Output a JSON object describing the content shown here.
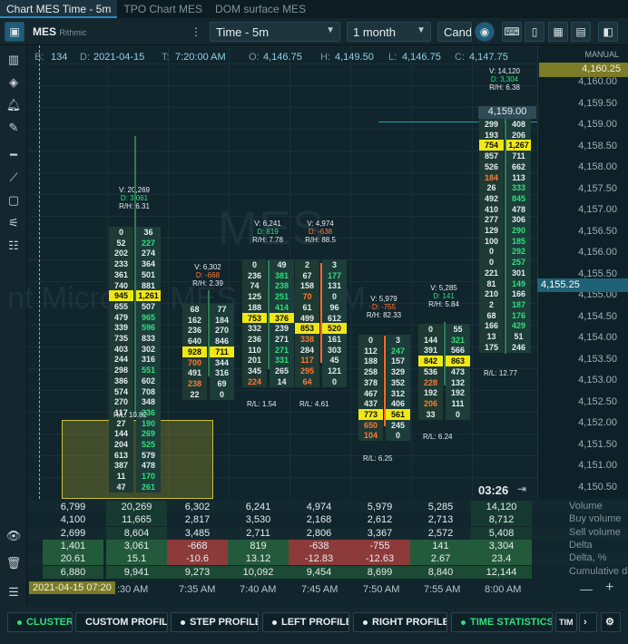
{
  "tabs": [
    "Chart MES Time - 5m",
    "TPO Chart MES",
    "DOM surface MES"
  ],
  "toolbar": {
    "symbol": "MES",
    "feed": "Rithmic",
    "timeframe": "Time - 5m",
    "period": "1 month",
    "chart_type": "Candl"
  },
  "info": {
    "b_label": "B:",
    "b": "134",
    "d_label": "D:",
    "d": "2021-04-15",
    "t_label": "T:",
    "t": "7:20:00 AM",
    "o_label": "O:",
    "o": "4,146.75",
    "h_label": "H:",
    "h": "4,149.50",
    "l_label": "L:",
    "l": "4,146.75",
    "c_label": "C:",
    "c": "4,147.75"
  },
  "watermark": {
    "symbol": "MES",
    "desc": "nt Micro for MES - MES M..."
  },
  "price_axis": {
    "manual_label": "MANUAL",
    "top_badge": "4,160.25",
    "current": "4,155.25",
    "highlight": "4,159.00",
    "levels": [
      "4,160.00",
      "4,159.50",
      "4,159.00",
      "4,158.50",
      "4,158.00",
      "4,157.50",
      "4,157.00",
      "4,156.50",
      "4,156.00",
      "4,155.50",
      "4,155.00",
      "4,154.50",
      "4,154.00",
      "4,153.50",
      "4,153.00",
      "4,152.50",
      "4,152.00",
      "4,151.50",
      "4,151.00",
      "4,150.50",
      "4,150.00"
    ]
  },
  "countdown": "03:26",
  "clusters": [
    {
      "stats": [
        "V: 20,269",
        "D: 3,061",
        "R/H: 6.31"
      ],
      "delta_pos": true,
      "rl": "R/L: 10.82",
      "rows": [
        [
          "0",
          "36"
        ],
        [
          "52",
          "227"
        ],
        [
          "202",
          "274"
        ],
        [
          "233",
          "364"
        ],
        [
          "361",
          "501"
        ],
        [
          "740",
          "881"
        ],
        [
          "945",
          "1,261"
        ],
        [
          "655",
          "507"
        ],
        [
          "479",
          "965"
        ],
        [
          "339",
          "596"
        ],
        [
          "735",
          "833"
        ],
        [
          "403",
          "302"
        ],
        [
          "244",
          "316"
        ],
        [
          "298",
          "551"
        ],
        [
          "386",
          "602"
        ],
        [
          "574",
          "708"
        ],
        [
          "270",
          "348"
        ],
        [
          "117",
          "236"
        ],
        [
          "27",
          "190"
        ],
        [
          "144",
          "269"
        ],
        [
          "204",
          "525"
        ],
        [
          "613",
          "579"
        ],
        [
          "387",
          "478"
        ],
        [
          "11",
          "170"
        ],
        [
          "47",
          "261"
        ]
      ]
    },
    {
      "stats": [
        "V: 6,302",
        "D: -668",
        "R/H: 2.39"
      ],
      "delta_pos": false,
      "rows": [
        [
          "68",
          "77"
        ],
        [
          "162",
          "184"
        ],
        [
          "236",
          "270"
        ],
        [
          "640",
          "846"
        ],
        [
          "928",
          "711"
        ],
        [
          "700",
          "344"
        ],
        [
          "491",
          "316"
        ],
        [
          "238",
          "69"
        ],
        [
          "22",
          "0"
        ]
      ]
    },
    {
      "stats": [
        "V: 6,241",
        "D: 819",
        "R/H: 7.78"
      ],
      "delta_pos": true,
      "rl": "R/L: 1.54",
      "rows": [
        [
          "0",
          "49"
        ],
        [
          "236",
          "381"
        ],
        [
          "74",
          "238"
        ],
        [
          "125",
          "251"
        ],
        [
          "188",
          "414"
        ],
        [
          "753",
          "376"
        ],
        [
          "332",
          "239"
        ],
        [
          "236",
          "271"
        ],
        [
          "110",
          "271"
        ],
        [
          "201",
          "331"
        ],
        [
          "345",
          "265"
        ],
        [
          "224",
          "14"
        ]
      ]
    },
    {
      "stats": [
        "V: 4,974",
        "D: -638",
        "R/H: 88.5"
      ],
      "delta_pos": false,
      "rl": "R/L: 4.61",
      "rows": [
        [
          "2",
          "3"
        ],
        [
          "67",
          "177"
        ],
        [
          "158",
          "131"
        ],
        [
          "70",
          "0"
        ],
        [
          "61",
          "96"
        ],
        [
          "499",
          "612"
        ],
        [
          "853",
          "520"
        ],
        [
          "338",
          "161"
        ],
        [
          "284",
          "303"
        ],
        [
          "117",
          "45"
        ],
        [
          "295",
          "121"
        ],
        [
          "64",
          "0"
        ]
      ]
    },
    {
      "stats": [
        "V: 5,979",
        "D: -755",
        "R/H: 82.33"
      ],
      "delta_pos": false,
      "rl": "R/L: 6.25",
      "rows": [
        [
          "0",
          "3"
        ],
        [
          "112",
          "247"
        ],
        [
          "188",
          "157"
        ],
        [
          "258",
          "329"
        ],
        [
          "378",
          "352"
        ],
        [
          "467",
          "312"
        ],
        [
          "437",
          "406"
        ],
        [
          "773",
          "561"
        ],
        [
          "650",
          "245"
        ],
        [
          "104",
          "0"
        ]
      ]
    },
    {
      "stats": [
        "V: 5,285",
        "D: 141",
        "R/H: 5.84"
      ],
      "delta_pos": true,
      "rl": "R/L: 6.24",
      "rows": [
        [
          "0",
          "55"
        ],
        [
          "144",
          "321"
        ],
        [
          "391",
          "566"
        ],
        [
          "842",
          "863"
        ],
        [
          "536",
          "473"
        ],
        [
          "228",
          "132"
        ],
        [
          "192",
          "192"
        ],
        [
          "206",
          "111"
        ],
        [
          "33",
          "0"
        ]
      ]
    },
    {
      "stats": [
        "V: 14,120",
        "D: 3,304",
        "R/H: 6.38"
      ],
      "delta_pos": true,
      "rl": "R/L: 12.77",
      "rows": [
        [
          "299",
          "408"
        ],
        [
          "193",
          "206"
        ],
        [
          "754",
          "1,267"
        ],
        [
          "857",
          "711"
        ],
        [
          "526",
          "662"
        ],
        [
          "184",
          "113"
        ],
        [
          "26",
          "333"
        ],
        [
          "492",
          "845"
        ],
        [
          "410",
          "478"
        ],
        [
          "277",
          "306"
        ],
        [
          "129",
          "290"
        ],
        [
          "100",
          "185"
        ],
        [
          "0",
          "292"
        ],
        [
          "0",
          "257"
        ],
        [
          "221",
          "301"
        ],
        [
          "81",
          "149"
        ],
        [
          "210",
          "166"
        ],
        [
          "2",
          "187"
        ],
        [
          "68",
          "176"
        ],
        [
          "166",
          "429"
        ],
        [
          "13",
          "51"
        ],
        [
          "175",
          "246"
        ]
      ]
    }
  ],
  "bottom": {
    "labels": [
      "Volume",
      "Buy volume",
      "Sell volume",
      "Delta",
      "Delta, %",
      "Cumulative delta"
    ],
    "rows": [
      [
        "6,799",
        "20,269",
        "6,302",
        "6,241",
        "4,974",
        "5,979",
        "5,285",
        "14,120"
      ],
      [
        "4,100",
        "11,665",
        "2,817",
        "3,530",
        "2,168",
        "2,612",
        "2,713",
        "8,712"
      ],
      [
        "2,699",
        "8,604",
        "3,485",
        "2,711",
        "2,806",
        "3,367",
        "2,572",
        "5,408"
      ],
      [
        "1,401",
        "3,061",
        "-668",
        "819",
        "-638",
        "-755",
        "141",
        "3,304"
      ],
      [
        "20.61",
        "15.1",
        "-10.6",
        "13.12",
        "-12.83",
        "-12.63",
        "2.67",
        "23.4"
      ],
      [
        "6,880",
        "9,941",
        "9,273",
        "10,092",
        "9,454",
        "8,699",
        "8,840",
        "12,144"
      ]
    ]
  },
  "time_axis": {
    "badge": "2021-04-15 07:20",
    "labels": [
      ":30 AM",
      "7:35 AM",
      "7:40 AM",
      "7:45 AM",
      "7:50 AM",
      "7:55 AM",
      "8:00 AM"
    ]
  },
  "footer": [
    "CLUSTER",
    "CUSTOM PROFILE",
    "STEP PROFILE",
    "LEFT PROFILE",
    "RIGHT PROFILE",
    "TIME STATISTICS",
    "TIM"
  ]
}
